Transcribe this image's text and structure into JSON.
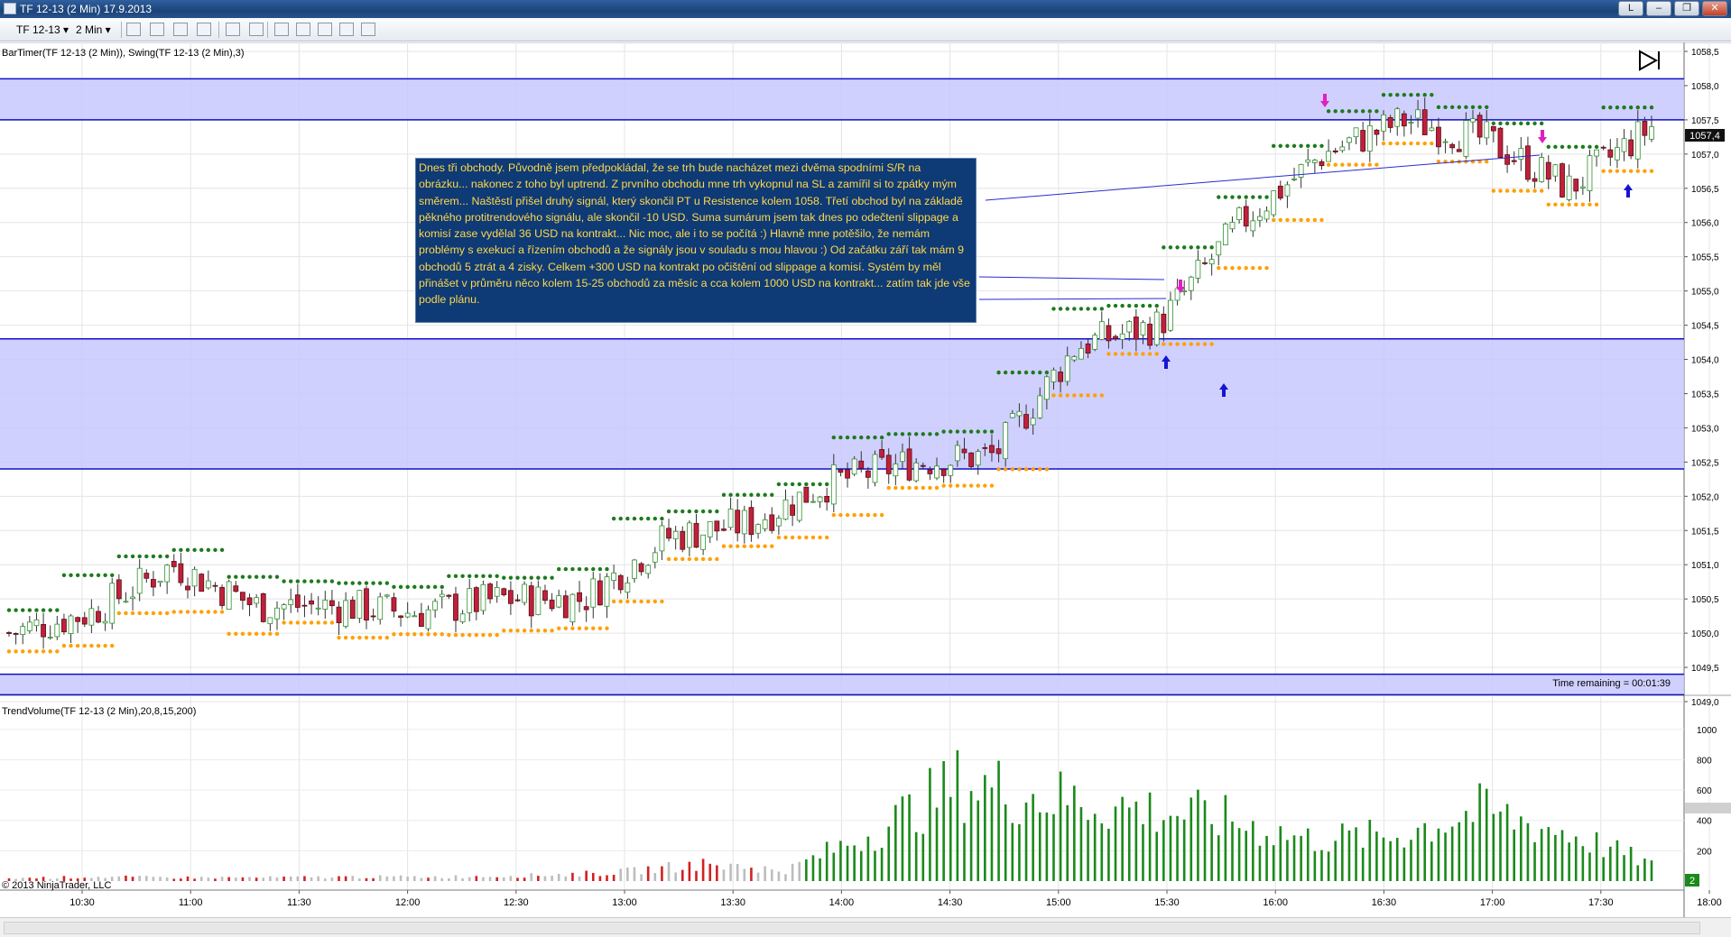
{
  "window": {
    "title": "TF 12-13 (2 Min)  17.9.2013",
    "controls": [
      "L",
      "–",
      "❐",
      "✕"
    ]
  },
  "toolbar": {
    "instrument": "TF 12-13",
    "interval": "2 Min"
  },
  "price_panel": {
    "indicator_label": "BarTimer(TF 12-13 (2 Min)), Swing(TF 12-13 (2 Min),3)",
    "time_remaining": "Time remaining = 00:01:39",
    "current_price": "1057,4",
    "y_ticks": [
      "1058,5",
      "1058,0",
      "1057,5",
      "1057,0",
      "1056,5",
      "1056,0",
      "1055,5",
      "1055,0",
      "1054,5",
      "1054,0",
      "1053,5",
      "1053,0",
      "1052,5",
      "1052,0",
      "1051,5",
      "1051,0",
      "1050,5",
      "1050,0",
      "1049,5",
      "1049,0"
    ],
    "ylim": [
      1049.0,
      1058.5
    ],
    "zones": [
      {
        "from": 1057.5,
        "to": 1058.1
      },
      {
        "from": 1052.4,
        "to": 1054.3
      },
      {
        "from": 1049.1,
        "to": 1049.4
      }
    ],
    "colors": {
      "zone_fill": "#c8c8ff",
      "zone_line": "#1010c8",
      "up": "#2f8f2f",
      "down": "#c0203a",
      "swing_high": "#1e7a1e",
      "swing_low": "#ffa000",
      "note_bg": "#0e3a76",
      "note_text": "#ffd84a"
    }
  },
  "note_text": "Dnes tři obchody. Původně jsem předpokládal, že se trh bude nacházet mezi dvěma spodními S/R na obrázku... nakonec z toho byl uptrend. Z prvního obchodu mne trh vykopnul na SL a zamířil si to zpátky mým směrem... Naštěstí přišel druhý signál, který skončil PT u Resistence kolem 1058. Třetí obchod byl na základě pěkného protitrendového signálu, ale skončil -10 USD. Suma sumárum jsem tak dnes po odečtení slippage a komisí zase vydělal 36 USD na kontrakt... Nic moc, ale i to se počítá :) Hlavně mne potěšilo, že nemám problémy s exekucí a řízením obchodů a že signály jsou v souladu s mou hlavou :) Od začátku září tak mám 9 obchodů 5 ztrát a 4 zisky. Celkem +300 USD na kontrakt po očištění od slippage a komisí. Systém by měl přinášet v průměru něco kolem 15-25 obchodů za měsíc a cca kolem 1000 USD na kontrakt... zatím tak jde vše podle plánu.",
  "volume_panel": {
    "indicator_label": "TrendVolume(TF 12-13 (2 Min),20,8,15,200)",
    "copyright": "© 2013 NinjaTrader, LLC",
    "y_ticks": [
      "1000",
      "800",
      "600",
      "400",
      "200"
    ],
    "ylim": [
      0,
      1100
    ],
    "last_value_badge": "2"
  },
  "x_axis": {
    "ticks": [
      "10:30",
      "11:00",
      "11:30",
      "12:00",
      "12:30",
      "13:00",
      "13:30",
      "14:00",
      "14:30",
      "15:00",
      "15:30",
      "16:00",
      "16:30",
      "17:00",
      "17:30",
      "18:00"
    ]
  },
  "chart_data": {
    "type": "candlestick",
    "x": [
      "10:30",
      "11:00",
      "11:30",
      "12:00",
      "12:30",
      "13:00",
      "13:30",
      "14:00",
      "14:30",
      "15:00",
      "15:30",
      "16:00",
      "16:30",
      "17:00",
      "17:30",
      "18:00"
    ],
    "close_path": [
      1050.0,
      1050.3,
      1051.0,
      1050.4,
      1050.4,
      1050.3,
      1050.5,
      1050.5,
      1051.4,
      1051.6,
      1052.2,
      1052.5,
      1052.6,
      1054.2,
      1054.5,
      1056.0,
      1057.0,
      1057.5,
      1057.2,
      1056.5,
      1057.4
    ],
    "volume_levels": [
      20,
      30,
      25,
      25,
      30,
      30,
      40,
      60,
      120,
      80,
      350,
      700,
      600,
      520,
      450,
      300,
      320,
      500,
      350,
      120
    ]
  }
}
